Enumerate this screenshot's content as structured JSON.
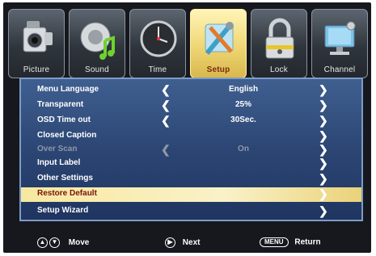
{
  "tabs": [
    {
      "label": "Picture",
      "icon": "camcorder-icon"
    },
    {
      "label": "Sound",
      "icon": "speaker-note-icon"
    },
    {
      "label": "Time",
      "icon": "clock-icon"
    },
    {
      "label": "Setup",
      "icon": "tools-icon",
      "active": true
    },
    {
      "label": "Lock",
      "icon": "padlock-icon"
    },
    {
      "label": "Channel",
      "icon": "satellite-dish-icon"
    }
  ],
  "menu": [
    {
      "label": "Menu Language",
      "value": "English",
      "left_arrow": true,
      "right_arrow": true
    },
    {
      "label": "Transparent",
      "value": "25%",
      "left_arrow": true,
      "right_arrow": true
    },
    {
      "label": "OSD Time out",
      "value": "30Sec.",
      "left_arrow": true,
      "right_arrow": true
    },
    {
      "label": "Closed Caption",
      "value": "",
      "left_arrow": false,
      "right_arrow": true
    },
    {
      "label": "Over Scan",
      "value": "On",
      "left_arrow": true,
      "right_arrow": true,
      "disabled": true
    },
    {
      "label": "Input Label",
      "value": "",
      "left_arrow": false,
      "right_arrow": true
    },
    {
      "label": "Other Settings",
      "value": "",
      "left_arrow": false,
      "right_arrow": true
    },
    {
      "label": "Restore Default",
      "value": "",
      "left_arrow": false,
      "right_arrow": true,
      "selected": true
    },
    {
      "label": "Setup Wizard",
      "value": "",
      "left_arrow": false,
      "right_arrow": true
    }
  ],
  "footer": {
    "move_label": "Move",
    "next_label": "Next",
    "menu_key": "MENU",
    "return_label": "Return"
  },
  "colors": {
    "panel": "#2c4674",
    "selected_row": "#f7e8a0",
    "active_tab": "#f1d97a"
  }
}
